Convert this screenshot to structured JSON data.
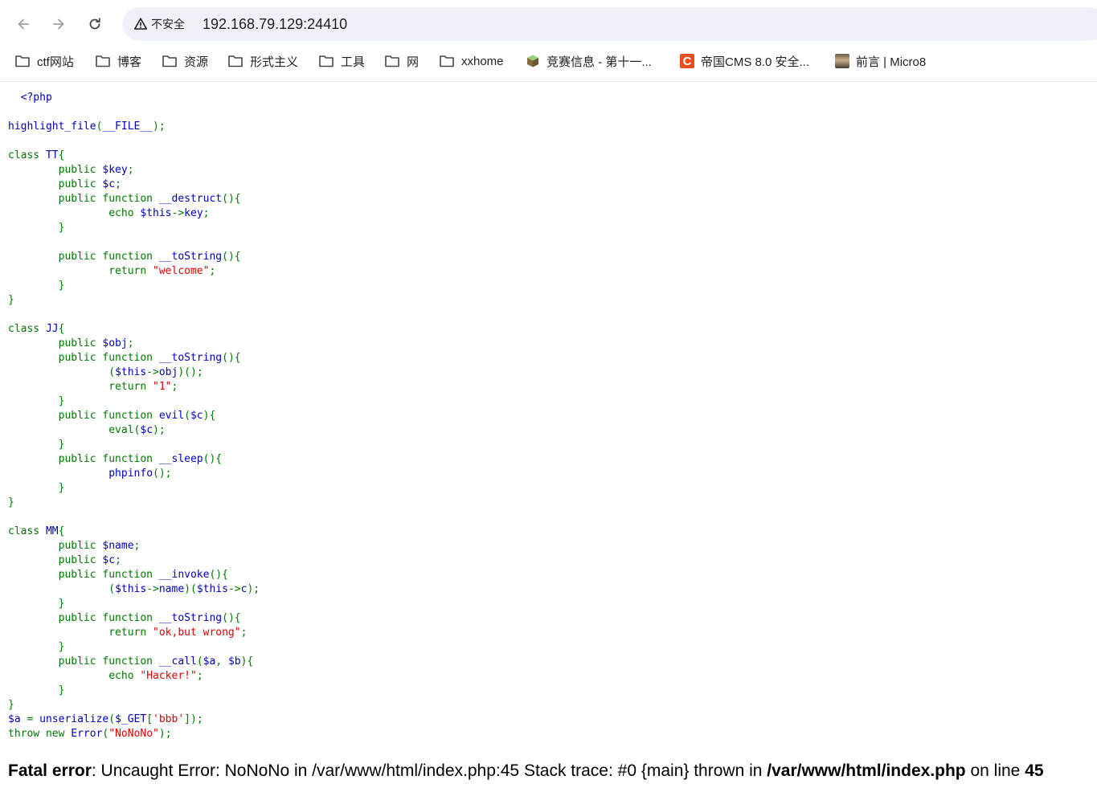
{
  "browser": {
    "security_label": "不安全",
    "url": "192.168.79.129:24410",
    "icons": {
      "back": "arrow-left-icon",
      "forward": "arrow-right-icon",
      "reload": "reload-icon",
      "security": "warning-triangle-icon"
    }
  },
  "bookmarks": [
    {
      "label": "ctf网站",
      "icon": "folder-icon"
    },
    {
      "label": "博客",
      "icon": "folder-icon"
    },
    {
      "label": "资源",
      "icon": "folder-icon"
    },
    {
      "label": "形式主义",
      "icon": "folder-icon"
    },
    {
      "label": "工具",
      "icon": "folder-icon"
    },
    {
      "label": "网",
      "icon": "folder-icon"
    },
    {
      "label": "xxhome",
      "icon": "folder-icon"
    },
    {
      "label": "竞赛信息 - 第十一...",
      "icon": "cube-favicon"
    },
    {
      "label": "帝国CMS 8.0 安全...",
      "icon": "c-favicon"
    },
    {
      "label": "前言 | Micro8",
      "icon": "avatar-favicon"
    }
  ],
  "code_lines": [
    [
      [
        "df",
        "  <?php"
      ]
    ],
    [],
    [
      [
        "df",
        "highlight_file"
      ],
      [
        "kw",
        "("
      ],
      [
        "df",
        "__FILE__"
      ],
      [
        "kw",
        ");"
      ]
    ],
    [],
    [
      [
        "kw",
        "class "
      ],
      [
        "df",
        "TT"
      ],
      [
        "kw",
        "{"
      ]
    ],
    [
      [
        "kw",
        "        public "
      ],
      [
        "df",
        "$key"
      ],
      [
        "kw",
        ";"
      ]
    ],
    [
      [
        "kw",
        "        public "
      ],
      [
        "df",
        "$c"
      ],
      [
        "kw",
        ";"
      ]
    ],
    [
      [
        "kw",
        "        public function "
      ],
      [
        "df",
        "__destruct"
      ],
      [
        "kw",
        "(){"
      ]
    ],
    [
      [
        "kw",
        "                echo "
      ],
      [
        "df",
        "$this"
      ],
      [
        "kw",
        "->"
      ],
      [
        "df",
        "key"
      ],
      [
        "kw",
        ";"
      ]
    ],
    [
      [
        "kw",
        "        }"
      ]
    ],
    [],
    [
      [
        "kw",
        "        public function "
      ],
      [
        "df",
        "__toString"
      ],
      [
        "kw",
        "(){"
      ]
    ],
    [
      [
        "kw",
        "                return "
      ],
      [
        "str",
        "\"welcome\""
      ],
      [
        "kw",
        ";"
      ]
    ],
    [
      [
        "kw",
        "        }"
      ]
    ],
    [
      [
        "kw",
        "}"
      ]
    ],
    [],
    [
      [
        "kw",
        "class "
      ],
      [
        "df",
        "JJ"
      ],
      [
        "kw",
        "{"
      ]
    ],
    [
      [
        "kw",
        "        public "
      ],
      [
        "df",
        "$obj"
      ],
      [
        "kw",
        ";"
      ]
    ],
    [
      [
        "kw",
        "        public function "
      ],
      [
        "df",
        "__toString"
      ],
      [
        "kw",
        "(){"
      ]
    ],
    [
      [
        "kw",
        "                ("
      ],
      [
        "df",
        "$this"
      ],
      [
        "kw",
        "->"
      ],
      [
        "df",
        "obj"
      ],
      [
        "kw",
        ")();"
      ]
    ],
    [
      [
        "kw",
        "                return "
      ],
      [
        "str",
        "\"1\""
      ],
      [
        "kw",
        ";"
      ]
    ],
    [
      [
        "kw",
        "        }"
      ]
    ],
    [
      [
        "kw",
        "        public function "
      ],
      [
        "df",
        "evil"
      ],
      [
        "kw",
        "("
      ],
      [
        "df",
        "$c"
      ],
      [
        "kw",
        "){"
      ]
    ],
    [
      [
        "kw",
        "                eval("
      ],
      [
        "df",
        "$c"
      ],
      [
        "kw",
        ");"
      ]
    ],
    [
      [
        "kw",
        "        }"
      ]
    ],
    [
      [
        "kw",
        "        public function "
      ],
      [
        "df",
        "__sleep"
      ],
      [
        "kw",
        "(){"
      ]
    ],
    [
      [
        "kw",
        "                "
      ],
      [
        "df",
        "phpinfo"
      ],
      [
        "kw",
        "();"
      ]
    ],
    [
      [
        "kw",
        "        }"
      ]
    ],
    [
      [
        "kw",
        "}"
      ]
    ],
    [],
    [
      [
        "kw",
        "class "
      ],
      [
        "df",
        "MM"
      ],
      [
        "kw",
        "{"
      ]
    ],
    [
      [
        "kw",
        "        public "
      ],
      [
        "df",
        "$name"
      ],
      [
        "kw",
        ";"
      ]
    ],
    [
      [
        "kw",
        "        public "
      ],
      [
        "df",
        "$c"
      ],
      [
        "kw",
        ";"
      ]
    ],
    [
      [
        "kw",
        "        public function "
      ],
      [
        "df",
        "__invoke"
      ],
      [
        "kw",
        "(){"
      ]
    ],
    [
      [
        "kw",
        "                ("
      ],
      [
        "df",
        "$this"
      ],
      [
        "kw",
        "->"
      ],
      [
        "df",
        "name"
      ],
      [
        "kw",
        ")("
      ],
      [
        "df",
        "$this"
      ],
      [
        "kw",
        "->"
      ],
      [
        "df",
        "c"
      ],
      [
        "kw",
        ");"
      ]
    ],
    [
      [
        "kw",
        "        }"
      ]
    ],
    [
      [
        "kw",
        "        public function "
      ],
      [
        "df",
        "__toString"
      ],
      [
        "kw",
        "(){"
      ]
    ],
    [
      [
        "kw",
        "                return "
      ],
      [
        "str",
        "\"ok,but wrong\""
      ],
      [
        "kw",
        ";"
      ]
    ],
    [
      [
        "kw",
        "        }"
      ]
    ],
    [
      [
        "kw",
        "        public function "
      ],
      [
        "df",
        "__call"
      ],
      [
        "kw",
        "("
      ],
      [
        "df",
        "$a"
      ],
      [
        "kw",
        ", "
      ],
      [
        "df",
        "$b"
      ],
      [
        "kw",
        "){"
      ]
    ],
    [
      [
        "kw",
        "                echo "
      ],
      [
        "str",
        "\"Hacker!\""
      ],
      [
        "kw",
        ";"
      ]
    ],
    [
      [
        "kw",
        "        }"
      ]
    ],
    [
      [
        "kw",
        "}"
      ]
    ],
    [
      [
        "df",
        "$a "
      ],
      [
        "kw",
        "= "
      ],
      [
        "df",
        "unserialize"
      ],
      [
        "kw",
        "("
      ],
      [
        "df",
        "$_GET"
      ],
      [
        "kw",
        "["
      ],
      [
        "str",
        "'bbb'"
      ],
      [
        "kw",
        "]);"
      ]
    ],
    [
      [
        "kw",
        "throw new "
      ],
      [
        "df",
        "Error"
      ],
      [
        "kw",
        "("
      ],
      [
        "str",
        "\"NoNoNo\""
      ],
      [
        "kw",
        ");"
      ]
    ]
  ],
  "error": {
    "label": "Fatal error",
    "message": ": Uncaught Error: NoNoNo in /var/www/html/index.php:45 Stack trace: #0 {main} thrown in ",
    "file": "/var/www/html/index.php",
    "on_line_text": " on line ",
    "line": "45"
  }
}
